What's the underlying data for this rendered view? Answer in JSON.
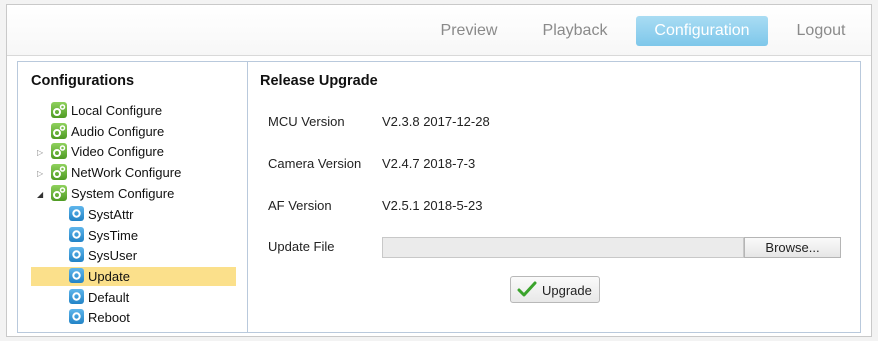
{
  "nav": {
    "preview": "Preview",
    "playback": "Playback",
    "configuration": "Configuration",
    "logout": "Logout",
    "active_color": "#8fd0ee"
  },
  "sidebar": {
    "title": "Configurations",
    "items": [
      {
        "label": "Local Configure",
        "icon": "gear-icon"
      },
      {
        "label": "Audio Configure",
        "icon": "gear-icon"
      },
      {
        "label": "Video Configure",
        "icon": "gear-icon",
        "expander": "collapsed"
      },
      {
        "label": "NetWork Configure",
        "icon": "gear-icon",
        "expander": "collapsed"
      },
      {
        "label": "System Configure",
        "icon": "gear-icon",
        "expander": "expanded"
      },
      {
        "label": "SystAttr",
        "icon": "settings-icon"
      },
      {
        "label": "SysTime",
        "icon": "settings-icon"
      },
      {
        "label": "SysUser",
        "icon": "settings-icon"
      },
      {
        "label": "Update",
        "icon": "settings-icon",
        "selected": true
      },
      {
        "label": "Default",
        "icon": "settings-icon"
      },
      {
        "label": "Reboot",
        "icon": "settings-icon"
      }
    ]
  },
  "main": {
    "title": "Release Upgrade",
    "mcu_label": "MCU Version",
    "mcu_value": "V2.3.8 2017-12-28",
    "camera_label": "Camera Version",
    "camera_value": "V2.4.7 2018-7-3",
    "af_label": "AF Version",
    "af_value": "V2.5.1 2018-5-23",
    "update_label": "Update File",
    "update_value": "",
    "browse_label": "Browse...",
    "upgrade_label": "Upgrade"
  }
}
